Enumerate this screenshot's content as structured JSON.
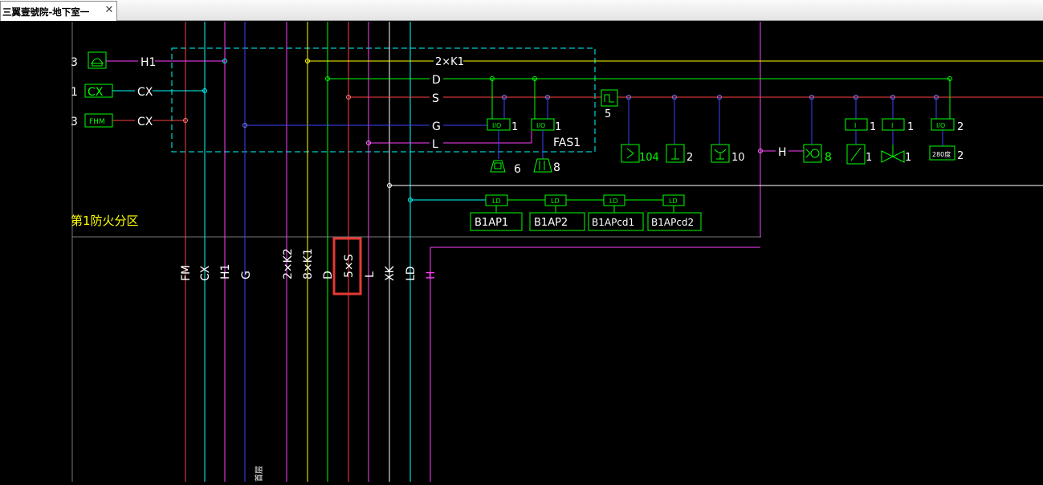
{
  "tab": {
    "title": "三翼壹號院-地下室一",
    "close_glyph": "✕"
  },
  "colors": {
    "background": "#000000",
    "green": "#00ff00",
    "cyan": "#00ffff",
    "yellow": "#ffff00",
    "red": "#ff4040",
    "magenta": "#ff40ff",
    "blue": "#4040ff",
    "white": "#ffffff",
    "highlight": "#e53935"
  },
  "diagram": {
    "left_legend": [
      {
        "count": "3",
        "icon": "telephone-icon",
        "bus": "H1"
      },
      {
        "count": "1",
        "box": "CX",
        "bus": "CX"
      },
      {
        "count": "3",
        "box": "FHM",
        "bus": "CX"
      }
    ],
    "bus_labels": {
      "k1": "2×K1",
      "d": "D",
      "s": "S",
      "g": "G",
      "l": "L"
    },
    "io_module": "I/O",
    "input_module": "I",
    "io_counts": {
      "io1": "1",
      "io2": "1",
      "in1": "1",
      "in2": "1",
      "io3": "2"
    },
    "fas_label": "FAS1",
    "manual_alarm": {
      "icon": "manual-alarm-icon",
      "count": "6"
    },
    "hydrant": {
      "icon": "hydrant-button-icon",
      "count": "8"
    },
    "loop_box_count": "5",
    "devices": [
      {
        "icon": "smoke-detector-icon",
        "count": "104"
      },
      {
        "icon": "heat-detector-icon",
        "count": "2"
      },
      {
        "icon": "sprinkler-flow-icon",
        "count": "10"
      },
      {
        "icon": "alarm-bell-icon",
        "prefix": "H",
        "count": "8"
      },
      {
        "icon": "flow-switch-icon",
        "count": "1"
      },
      {
        "icon": "signal-valve-icon",
        "count": "1"
      },
      {
        "icon": "fire-damper-icon",
        "label": "280度",
        "count": "2"
      }
    ],
    "ld_label": "LD",
    "panels": [
      "B1AP1",
      "B1AP2",
      "B1APcd1",
      "B1APcd2"
    ],
    "zone_label": "第1防火分区",
    "trunk_labels": [
      "FM",
      "CX",
      "H1",
      "G",
      "2×K2",
      "8×K1",
      "D",
      "5×S",
      "L",
      "XK",
      "LD",
      "H"
    ],
    "bottom_text": "首层"
  }
}
